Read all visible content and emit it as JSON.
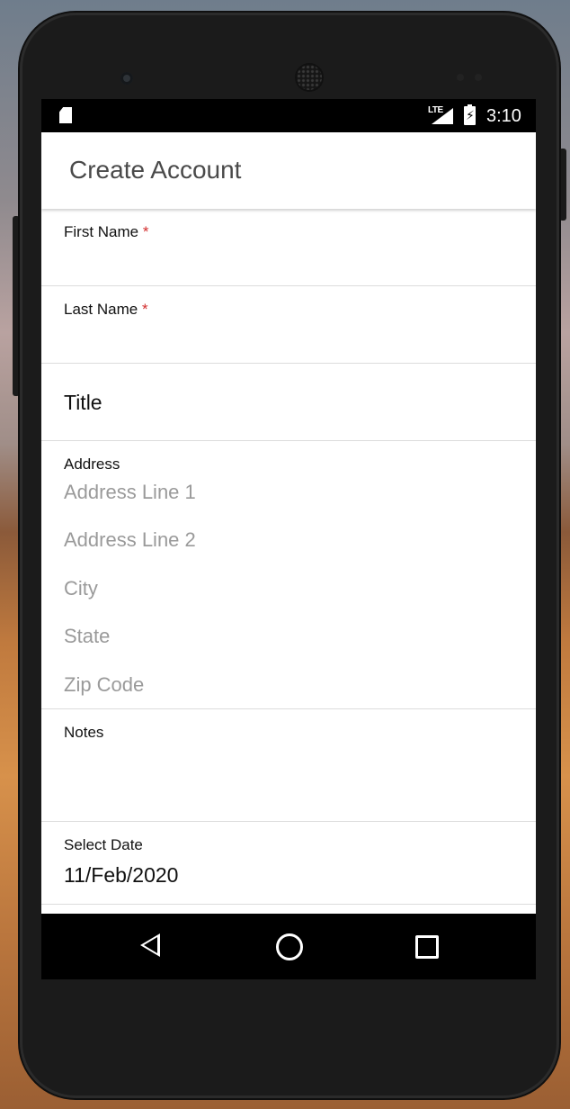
{
  "status_bar": {
    "network": "LTE",
    "time": "3:10"
  },
  "app_bar": {
    "title": "Create Account"
  },
  "form": {
    "first_name": {
      "label": "First Name",
      "required_mark": "*"
    },
    "last_name": {
      "label": "Last Name",
      "required_mark": "*"
    },
    "title": {
      "placeholder": "Title"
    },
    "address": {
      "label": "Address",
      "line1_placeholder": "Address Line 1",
      "line2_placeholder": "Address Line 2",
      "city_placeholder": "City",
      "state_placeholder": "State",
      "zip_placeholder": "Zip Code"
    },
    "notes": {
      "label": "Notes"
    },
    "date": {
      "label": "Select Date",
      "value": "11/Feb/2020"
    }
  },
  "nav_bar": {
    "icons": [
      "back-icon",
      "home-icon",
      "recents-icon"
    ]
  }
}
